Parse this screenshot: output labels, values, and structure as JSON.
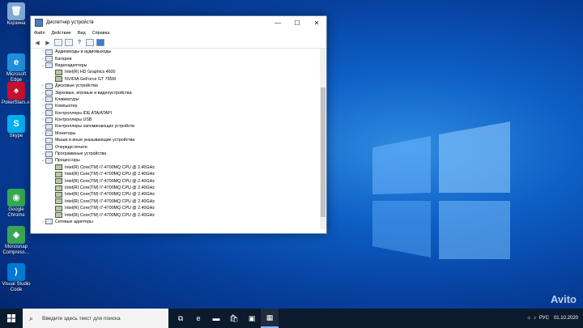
{
  "desktop": {
    "icons": [
      {
        "label": "Корзина",
        "icon": "recycle-bin-icon",
        "color": "#7fa8d6"
      },
      {
        "label": "Microsoft Edge",
        "icon": "edge-icon",
        "color": "#1f8fdc"
      },
      {
        "label": "PokerStars.e…",
        "icon": "pokerstars-icon",
        "color": "#c8102e"
      },
      {
        "label": "Skype",
        "icon": "skype-icon",
        "color": "#00aff0"
      },
      {
        "label": "Google Chrome",
        "icon": "chrome-icon",
        "color": "#34a853"
      },
      {
        "label": "Monosnap Compress…",
        "icon": "monosnap-icon",
        "color": "#3aa655"
      },
      {
        "label": "Visual Studio Code",
        "icon": "vscode-icon",
        "color": "#0078d4"
      }
    ]
  },
  "window": {
    "title": "Диспетчер устройств",
    "menu": [
      "Файл",
      "Действие",
      "Вид",
      "Справка"
    ],
    "tree": [
      {
        "label": "Аудиовходы и аудиовыходы",
        "indent": 0,
        "arrow": "›"
      },
      {
        "label": "Батареи",
        "indent": 0,
        "arrow": "›"
      },
      {
        "label": "Видеоадаптеры",
        "indent": 0,
        "arrow": "⌄"
      },
      {
        "label": "Intel(R) HD Graphics 4600",
        "indent": 1,
        "arrow": ""
      },
      {
        "label": "NVIDIA GeForce GT 755M",
        "indent": 1,
        "arrow": ""
      },
      {
        "label": "Дисковые устройства",
        "indent": 0,
        "arrow": "›"
      },
      {
        "label": "Звуковые, игровые и видеоустройства",
        "indent": 0,
        "arrow": "›"
      },
      {
        "label": "Клавиатуры",
        "indent": 0,
        "arrow": "›"
      },
      {
        "label": "Компьютер",
        "indent": 0,
        "arrow": "›"
      },
      {
        "label": "Контроллеры IDE ATA/ATAPI",
        "indent": 0,
        "arrow": "›"
      },
      {
        "label": "Контроллеры USB",
        "indent": 0,
        "arrow": "›"
      },
      {
        "label": "Контроллеры запоминающих устройств",
        "indent": 0,
        "arrow": "›"
      },
      {
        "label": "Мониторы",
        "indent": 0,
        "arrow": "›"
      },
      {
        "label": "Мыши и иные указывающие устройства",
        "indent": 0,
        "arrow": "›"
      },
      {
        "label": "Очереди печати",
        "indent": 0,
        "arrow": "›"
      },
      {
        "label": "Программные устройства",
        "indent": 0,
        "arrow": "›"
      },
      {
        "label": "Процессоры",
        "indent": 0,
        "arrow": "⌄"
      },
      {
        "label": "Intel(R) Core(TM) i7-4700MQ CPU @ 2.40GHz",
        "indent": 1,
        "arrow": ""
      },
      {
        "label": "Intel(R) Core(TM) i7-4700MQ CPU @ 2.40GHz",
        "indent": 1,
        "arrow": ""
      },
      {
        "label": "Intel(R) Core(TM) i7-4700MQ CPU @ 2.40GHz",
        "indent": 1,
        "arrow": ""
      },
      {
        "label": "Intel(R) Core(TM) i7-4700MQ CPU @ 2.40GHz",
        "indent": 1,
        "arrow": ""
      },
      {
        "label": "Intel(R) Core(TM) i7-4700MQ CPU @ 2.40GHz",
        "indent": 1,
        "arrow": ""
      },
      {
        "label": "Intel(R) Core(TM) i7-4700MQ CPU @ 2.40GHz",
        "indent": 1,
        "arrow": ""
      },
      {
        "label": "Intel(R) Core(TM) i7-4700MQ CPU @ 2.40GHz",
        "indent": 1,
        "arrow": ""
      },
      {
        "label": "Intel(R) Core(TM) i7-4700MQ CPU @ 2.40GHz",
        "indent": 1,
        "arrow": ""
      },
      {
        "label": "Сетевые адаптеры",
        "indent": 0,
        "arrow": "›"
      }
    ]
  },
  "taskbar": {
    "search_placeholder": "Введите здесь текст для поиска",
    "apps": [
      {
        "icon": "task-view-icon",
        "glyph": "⧉"
      },
      {
        "icon": "edge-icon",
        "glyph": "e"
      },
      {
        "icon": "file-explorer-icon",
        "glyph": "▬"
      },
      {
        "icon": "store-icon",
        "glyph": "🛍"
      },
      {
        "icon": "app-icon",
        "glyph": "▣"
      },
      {
        "icon": "device-manager-icon",
        "glyph": "▦"
      }
    ],
    "date": "01.10.2020",
    "language": "РУС"
  },
  "watermark": "Avito",
  "colors": {
    "accent": "#0078d7",
    "taskbar": "#0c1a2e"
  }
}
